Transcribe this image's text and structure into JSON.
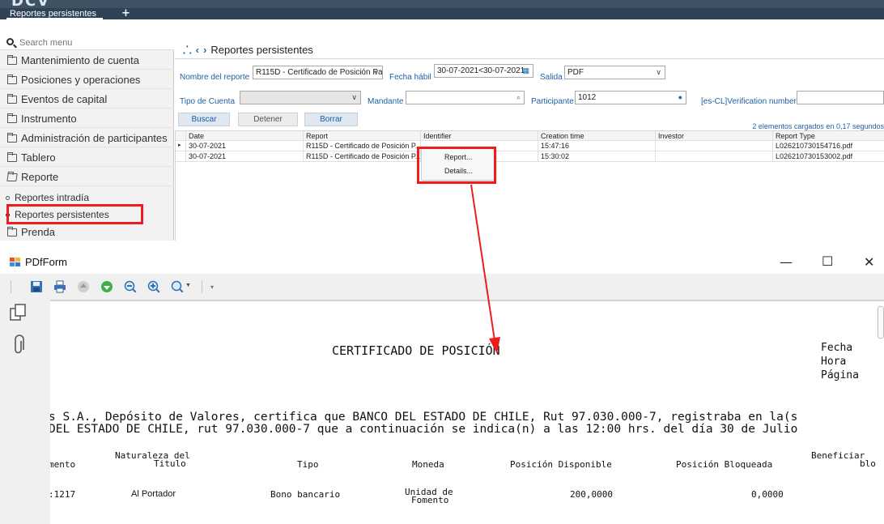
{
  "app": {
    "logo": "DCV",
    "open_tab": "Reportes persistentes",
    "add_tab_symbol": "+"
  },
  "sidebar": {
    "search_placeholder": "Search menu",
    "items": [
      {
        "label": "Mantenimiento de cuenta"
      },
      {
        "label": "Posiciones y operaciones"
      },
      {
        "label": "Eventos de capital"
      },
      {
        "label": "Instrumento"
      },
      {
        "label": "Administración de participantes"
      },
      {
        "label": "Tablero"
      },
      {
        "label": "Reporte"
      }
    ],
    "sub_items": [
      {
        "label": "Reportes intradía"
      },
      {
        "label": "Reportes persistentes"
      }
    ],
    "last_item": "Prenda"
  },
  "main": {
    "title": "Reportes persistentes",
    "filters": {
      "report_name_label": "Nombre del reporte",
      "report_name_value": "R115D - Certificado de Posición Pa",
      "business_date_label": "Fecha hábil",
      "business_date_value": "30-07-2021<30-07-2021",
      "output_label": "Salida",
      "output_value": "PDF",
      "account_type_label": "Tipo de Cuenta",
      "account_type_value": "",
      "mandante_label": "Mandante",
      "mandante_value": "",
      "participant_label": "Participante",
      "participant_value": "1012",
      "verification_label": "[es-CL]Verification number",
      "verification_value": ""
    },
    "buttons": {
      "search": "Buscar",
      "stop": "Detener",
      "clear": "Borrar"
    },
    "status": "2 elementos cargados en 0,17 segundos",
    "grid": {
      "columns": [
        "Date",
        "Report",
        "Identifier",
        "Creation time",
        "Investor",
        "Report Type"
      ],
      "rows": [
        {
          "date": "30-07-2021",
          "report": "R115D - Certificado de Posición P...",
          "identifier": "",
          "creation_time": "15:47:16",
          "investor": "",
          "report_type": "L026210730154716.pdf"
        },
        {
          "date": "30-07-2021",
          "report": "R115D - Certificado de Posición P...",
          "identifier": "",
          "creation_time": "15:30:02",
          "investor": "",
          "report_type": "L026210730153002.pdf"
        }
      ]
    },
    "context_menu": [
      "Report...",
      "Details..."
    ]
  },
  "pdf": {
    "window_title": "PDfForm",
    "document_title": "CERTIFICADO DE POSICIÓN",
    "header_labels": [
      "Fecha",
      "Hora",
      "Página"
    ],
    "line1": "s S.A., Depósito de Valores, certifica que BANCO  DEL ESTADO DE CHILE, Rut 97.030.000-7, registraba en la(s",
    "line2": " DEL ESTADO DE CHILE, rut 97.030.000-7 que a continuación se indica(n) a las 12:00 hrs. del día 30 de Julio",
    "table_headers": {
      "instrumento": "mento",
      "naturaleza_1": "Naturaleza del",
      "naturaleza_2": "Titulo",
      "tipo": "Tipo",
      "moneda": "Moneda",
      "disponible": "Posición Disponible",
      "bloqueada": "Posición Bloqueada",
      "beneficiario_1": "Beneficiar",
      "beneficiario_2": "blo"
    },
    "row": {
      "instrumento": ":1217",
      "naturaleza": "Al Portador",
      "tipo": "Bono bancario",
      "moneda_1": "Unidad de",
      "moneda_2": "Fomento",
      "disponible": "200,0000",
      "bloqueada": "0,0000"
    }
  },
  "colors": {
    "annotation": "#ee1c1c",
    "link_blue": "#1f5fa6",
    "header_dark": "#2e4356"
  }
}
